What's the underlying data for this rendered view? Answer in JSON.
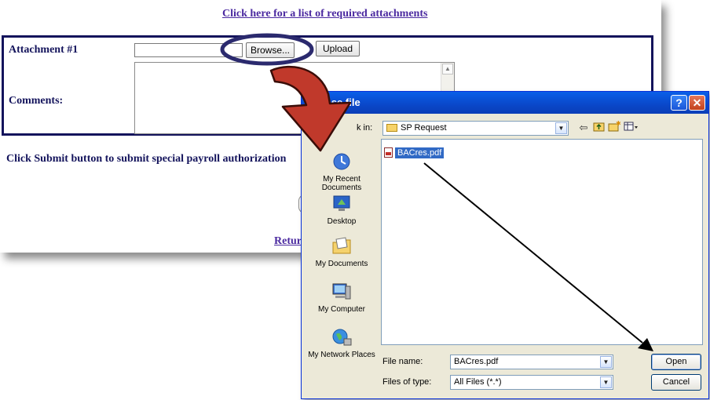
{
  "web_form": {
    "top_link": "Click here for a list of required attachments",
    "attachment_label": "Attachment #1",
    "browse_label": "Browse...",
    "upload_label": "Upload",
    "comments_label": "Comments:",
    "submit_text": "Click Submit button to submit special payroll authorization",
    "return_link": "Retur"
  },
  "dialog": {
    "title": "hoose file",
    "look_in_label": "k in:",
    "look_in_value": "SP Request",
    "files": [
      {
        "name": "BACres.pdf",
        "selected": true
      }
    ],
    "places": [
      {
        "label": "My Recent Documents",
        "icon": "recent-documents-icon"
      },
      {
        "label": "Desktop",
        "icon": "desktop-icon"
      },
      {
        "label": "My Documents",
        "icon": "my-documents-icon"
      },
      {
        "label": "My Computer",
        "icon": "my-computer-icon"
      },
      {
        "label": "My Network Places",
        "icon": "network-places-icon"
      }
    ],
    "file_name_label": "File name:",
    "file_name_value": "BACres.pdf",
    "file_type_label": "Files of type:",
    "file_type_value": "All Files (*.*)",
    "open_label": "Open",
    "cancel_label": "Cancel",
    "help_symbol": "?",
    "close_symbol": "✕"
  },
  "colors": {
    "form_border": "#14145c",
    "link": "#4b2aa0",
    "arrow_red": "#c0392b",
    "title_bar": "#0a47c9"
  }
}
